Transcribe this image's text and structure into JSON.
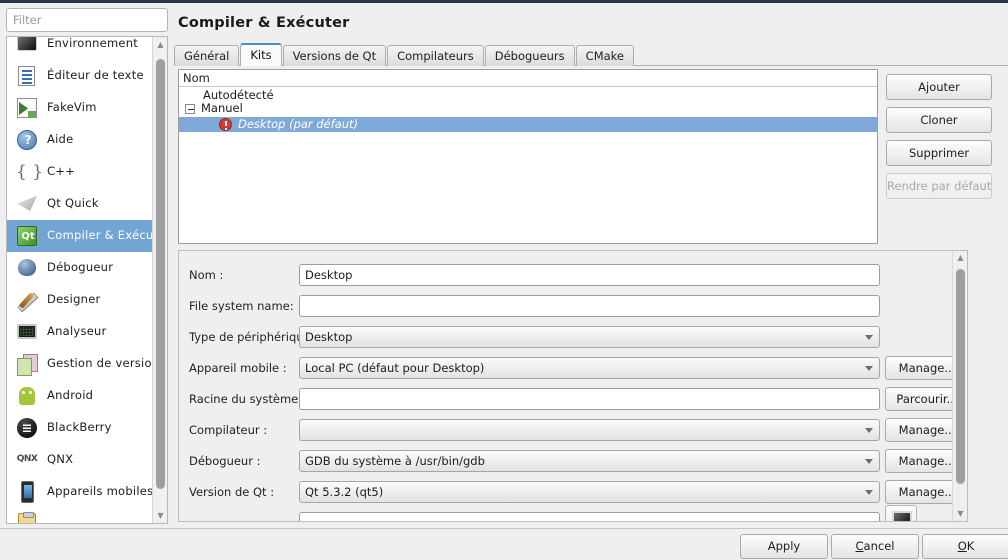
{
  "filter": {
    "placeholder": "Filter",
    "value": ""
  },
  "sidebar": {
    "items": [
      {
        "label": "Environnement",
        "icon": "environment-icon"
      },
      {
        "label": "Éditeur de texte",
        "icon": "text-editor-icon"
      },
      {
        "label": "FakeVim",
        "icon": "fakevim-icon"
      },
      {
        "label": "Aide",
        "icon": "help-icon"
      },
      {
        "label": "C++",
        "icon": "cpp-icon"
      },
      {
        "label": "Qt Quick",
        "icon": "qt-quick-icon"
      },
      {
        "label": "Compiler & Exécuter",
        "icon": "build-run-icon"
      },
      {
        "label": "Débogueur",
        "icon": "debugger-icon"
      },
      {
        "label": "Designer",
        "icon": "designer-icon"
      },
      {
        "label": "Analyseur",
        "icon": "analyzer-icon"
      },
      {
        "label": "Gestion de versions",
        "icon": "version-control-icon"
      },
      {
        "label": "Android",
        "icon": "android-icon"
      },
      {
        "label": "BlackBerry",
        "icon": "blackberry-icon"
      },
      {
        "label": "QNX",
        "icon": "qnx-icon"
      },
      {
        "label": "Appareils mobiles",
        "icon": "mobile-devices-icon"
      }
    ],
    "selected_index": 6
  },
  "header": {
    "title": "Compiler & Exécuter"
  },
  "tabs": [
    {
      "label": "Général",
      "active": false
    },
    {
      "label": "Kits",
      "active": true
    },
    {
      "label": "Versions de Qt",
      "active": false
    },
    {
      "label": "Compilateurs",
      "active": false
    },
    {
      "label": "Débogueurs",
      "active": false
    },
    {
      "label": "CMake",
      "active": false
    }
  ],
  "kit_tree": {
    "column_header": "Nom",
    "rows": [
      {
        "label": "Autodétecté",
        "level": 1,
        "expander": false,
        "error": false,
        "selected": false
      },
      {
        "label": "Manuel",
        "level": 0,
        "expander": true,
        "error": false,
        "selected": false
      },
      {
        "label": "Desktop (par défaut)",
        "level": 2,
        "expander": false,
        "error": true,
        "selected": true
      }
    ]
  },
  "kit_buttons": [
    {
      "label": "Ajouter",
      "enabled": true
    },
    {
      "label": "Cloner",
      "enabled": true
    },
    {
      "label": "Supprimer",
      "enabled": true
    },
    {
      "label": "Rendre par défaut",
      "enabled": false
    }
  ],
  "form": {
    "rows": [
      {
        "label": "Nom :",
        "type": "text",
        "value": "Desktop",
        "enabled": true,
        "side_button": null
      },
      {
        "label": "File system name:",
        "type": "text",
        "value": "",
        "enabled": true,
        "side_button": null
      },
      {
        "label": "Type de périphérique :",
        "type": "combo",
        "value": "Desktop",
        "enabled": true,
        "side_button": null
      },
      {
        "label": "Appareil mobile :",
        "type": "combo",
        "value": "Local PC (défaut pour Desktop)",
        "enabled": true,
        "side_button": "Manage..."
      },
      {
        "label": "Racine du système :",
        "type": "text",
        "value": "",
        "enabled": true,
        "side_button": "Parcourir..."
      },
      {
        "label": "Compilateur :",
        "type": "combo",
        "value": "",
        "enabled": false,
        "side_button": "Manage..."
      },
      {
        "label": "Débogueur :",
        "type": "combo",
        "value": "GDB du système à /usr/bin/gdb",
        "enabled": true,
        "side_button": "Manage..."
      },
      {
        "label": "Version de Qt :",
        "type": "combo",
        "value": "Qt 5.3.2 (qt5)",
        "enabled": true,
        "side_button": "Manage..."
      },
      {
        "label": "",
        "type": "text",
        "value": "",
        "enabled": true,
        "side_button": null
      }
    ],
    "device_icon_button": "desktop-monitor-icon"
  },
  "dialog_buttons": {
    "apply": {
      "label": "Apply",
      "mnemonic": ""
    },
    "cancel": {
      "pre": "",
      "mnemonic": "C",
      "post": "ancel"
    },
    "ok": {
      "pre": "",
      "mnemonic": "O",
      "post": "K"
    }
  },
  "colors": {
    "selection_blue": "#72a5d4",
    "tree_selection_blue": "#7fa9d6",
    "active_tab_border": "#4a90c4",
    "error_red": "#d63b33",
    "window_bg": "#efefef",
    "top_strip": "#2b3347"
  }
}
